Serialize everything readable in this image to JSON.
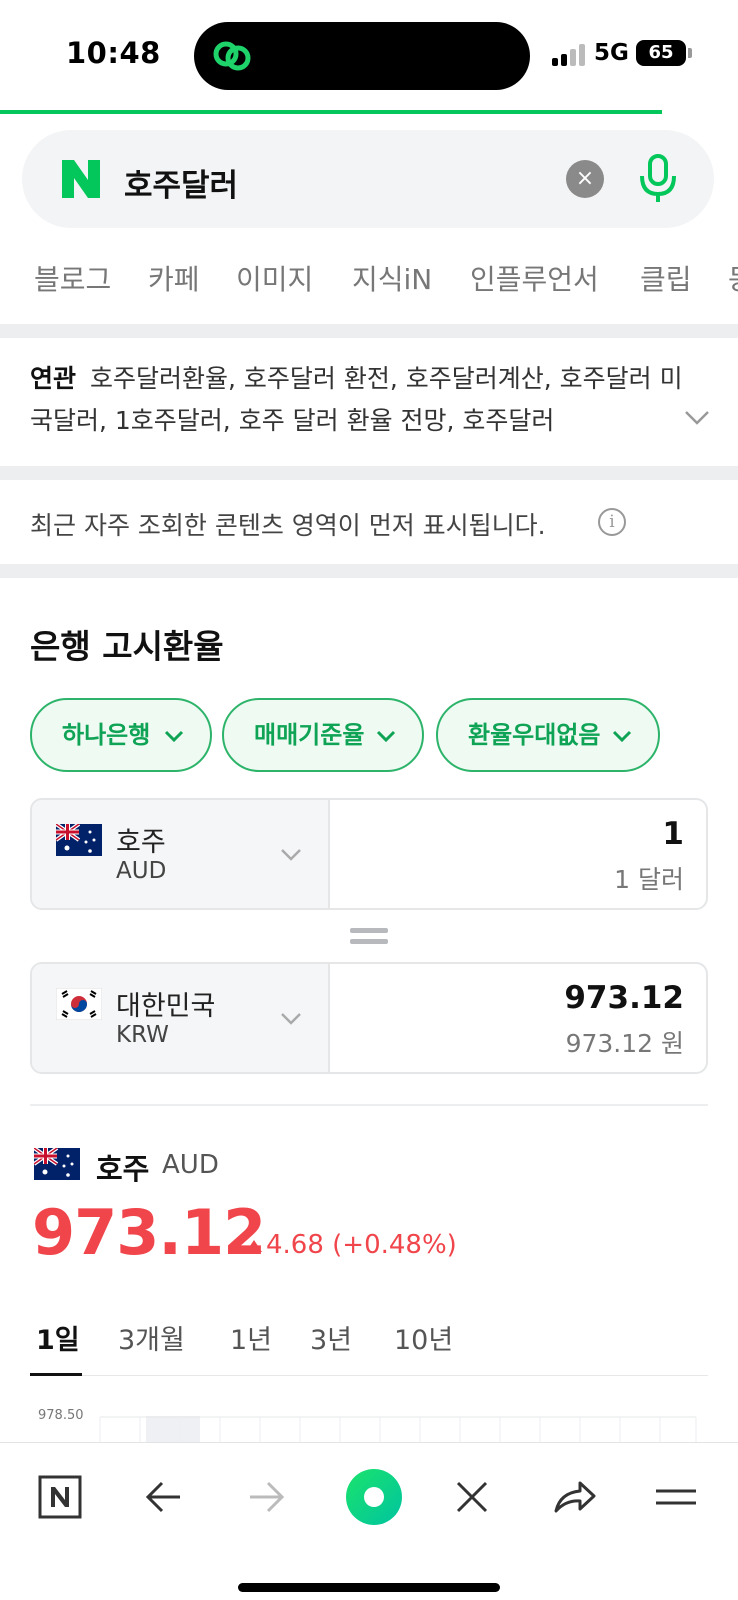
{
  "status_bar": {
    "time": "10:48",
    "network": "5G",
    "battery": "65"
  },
  "search": {
    "query": "호주달러",
    "clear_label": "×"
  },
  "tabs": [
    "블로그",
    "카페",
    "이미지",
    "지식iN",
    "인플루언서",
    "클립",
    "동"
  ],
  "related": {
    "label": "연관",
    "text": "호주달러환율, 호주달러 환전, 호주달러계산, 호주달러 미국달러, 1호주달러, 호주 달러 환율 전망, 호주달러"
  },
  "notice": {
    "text": "최근 자주 조회한 콘텐츠 영역이 먼저 표시됩니다.",
    "info": "i"
  },
  "section": {
    "title": "은행 고시환율"
  },
  "filters": [
    "하나은행",
    "매매기준율",
    "환율우대없음"
  ],
  "converter": {
    "from": {
      "name": "호주",
      "code": "AUD",
      "value": "1",
      "sub": "1 달러"
    },
    "to": {
      "name": "대한민국",
      "code": "KRW",
      "value": "973.12",
      "sub": "973.12 원"
    }
  },
  "rate": {
    "country": "호주",
    "code": "AUD",
    "value": "973.12",
    "change": "4.68 (+0.48%)",
    "direction": "up"
  },
  "periods": [
    "1일",
    "3개월",
    "1년",
    "3년",
    "10년"
  ],
  "active_period": "1일",
  "chart": {
    "ylabel_top": "978.50"
  },
  "colors": {
    "accent": "#03c75a",
    "up": "#f0454b"
  }
}
